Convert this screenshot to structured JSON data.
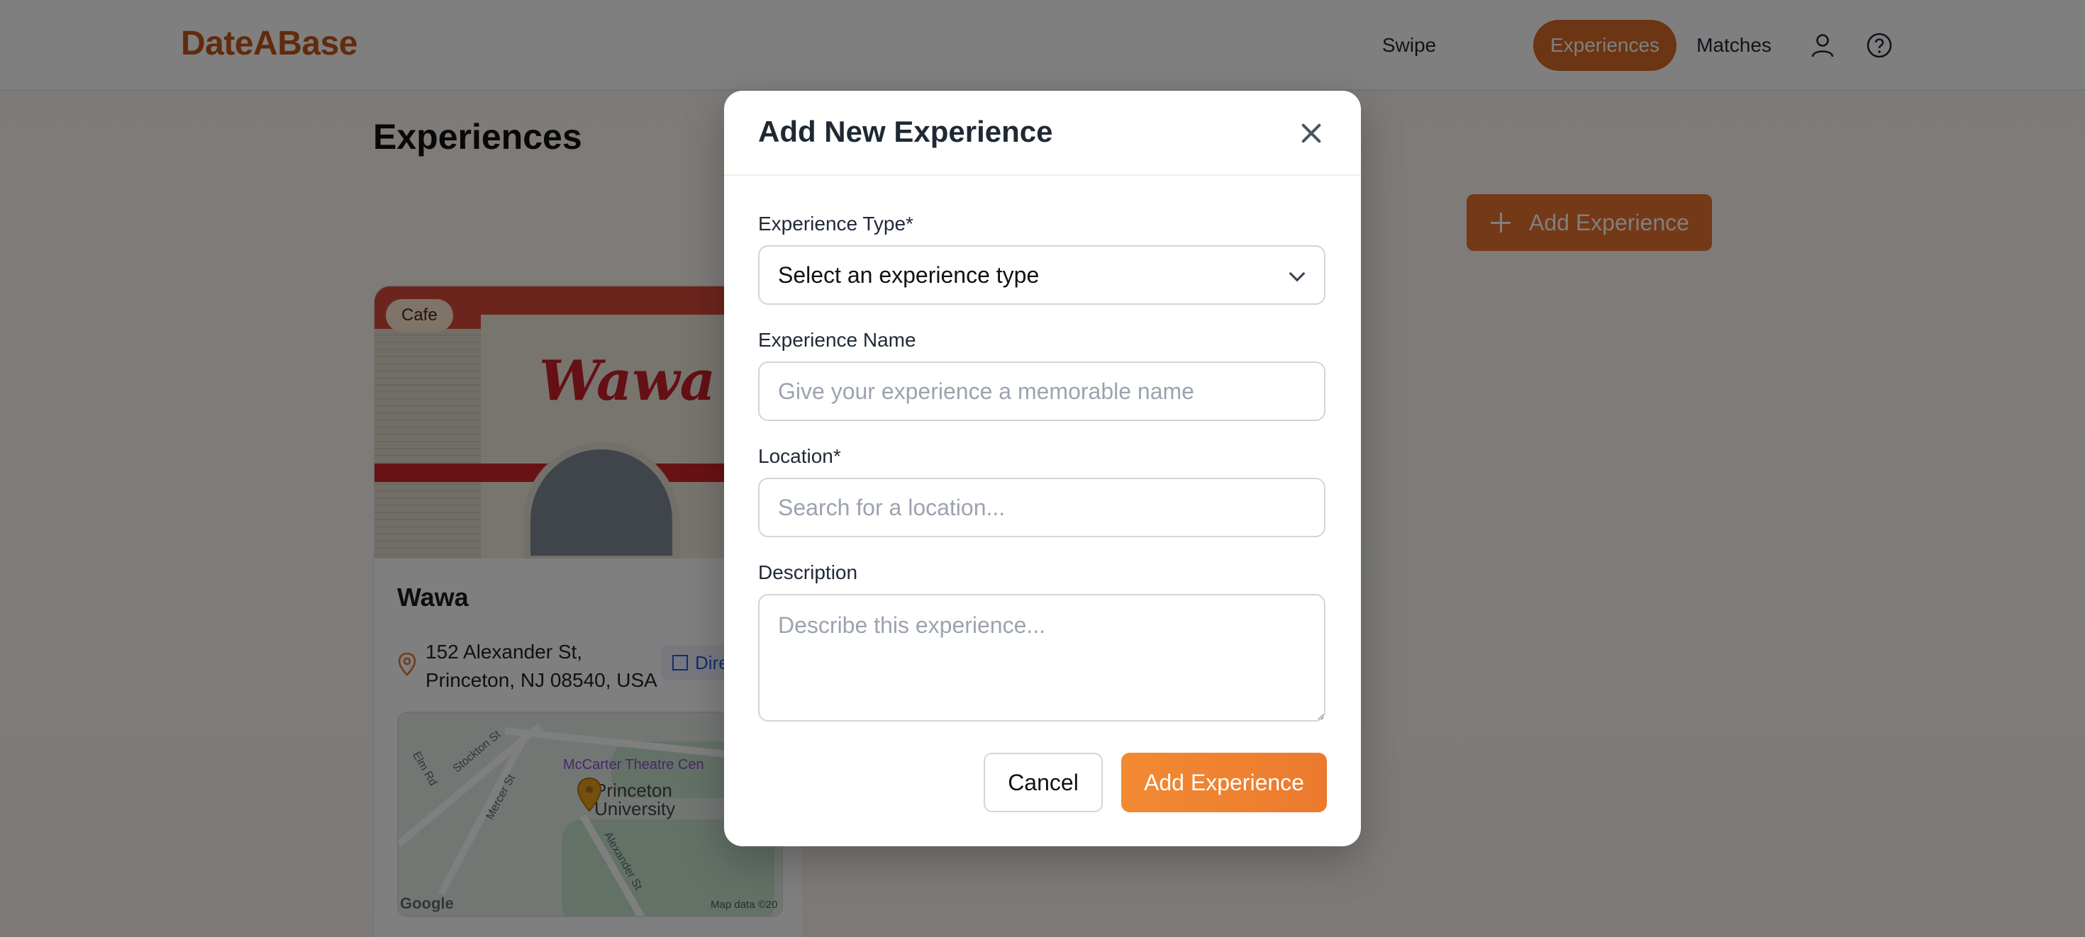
{
  "app": {
    "logo": "DateABase"
  },
  "nav": {
    "items": [
      {
        "label": "Swipe",
        "active": false
      },
      {
        "label": "Experiences",
        "active": true
      },
      {
        "label": "Matches",
        "active": false
      }
    ],
    "icons": [
      "user-icon",
      "help-icon"
    ]
  },
  "page": {
    "title": "Experiences",
    "add_button_label": "Add Experience"
  },
  "card": {
    "category": "Cafe",
    "name": "Wawa",
    "address_line1": "152 Alexander St,",
    "address_line2": "Princeton, NJ 08540, USA",
    "directions_label": "Dire",
    "map": {
      "labels": [
        "McCarter Theatre Cen",
        "Princeton",
        "University",
        "Elm Rd",
        "Stockton St",
        "Mercer St",
        "Alexander St"
      ],
      "google": "Google",
      "map_data": "Map data ©20"
    },
    "storefront_text": "Wawa"
  },
  "modal": {
    "title": "Add New Experience",
    "type_label": "Experience Type*",
    "type_value": "Select an experience type",
    "name_label": "Experience Name",
    "name_placeholder": "Give your experience a memorable name",
    "location_label": "Location*",
    "location_placeholder": "Search for a location...",
    "description_label": "Description",
    "description_placeholder": "Describe this experience...",
    "cancel_label": "Cancel",
    "submit_label": "Add Experience"
  },
  "colors": {
    "brand": "#c2571a",
    "accent": "#ec7a2e",
    "overlay": "rgba(0,0,0,0.5)"
  }
}
